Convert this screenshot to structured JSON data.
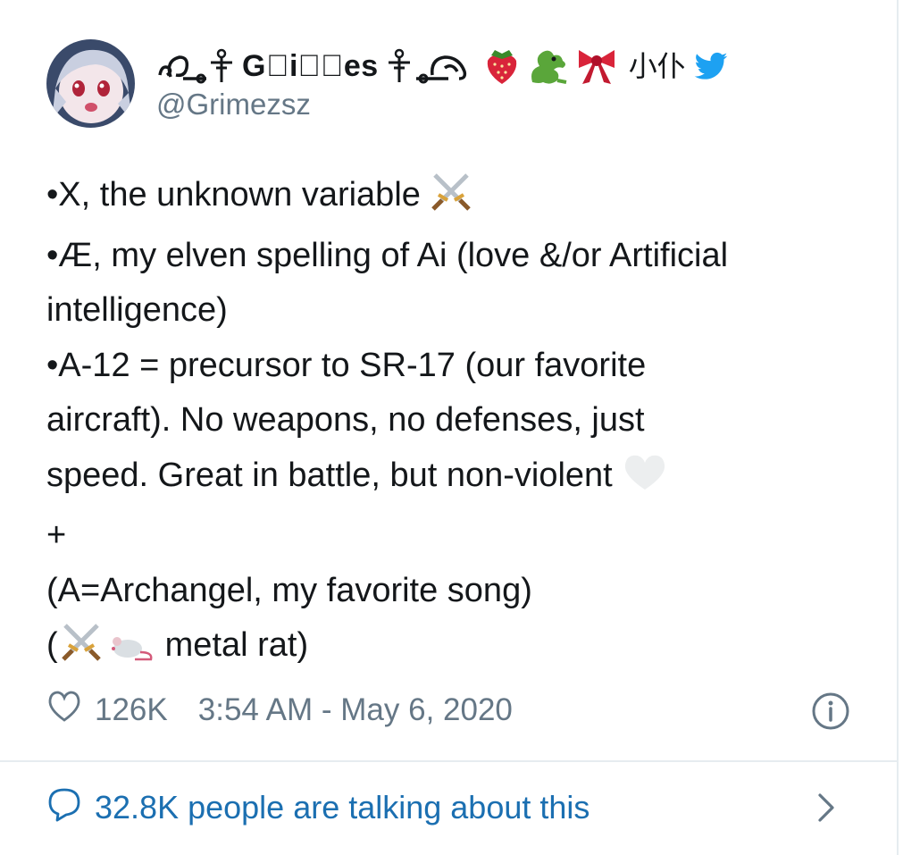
{
  "tweet": {
    "display_name": "G𝕽i⃝⃝es",
    "display_name_suffix": "小仆",
    "handle": "@Grimezsz",
    "lines": [
      "•X, the unknown variable",
      "•Æ, my elven spelling of Ai (love &/or Artificial",
      "intelligence)",
      "•A-12 = precursor to SR-17 (our favorite",
      "aircraft).  No weapons, no defenses, just",
      "speed.  Great in battle, but non-violent",
      "+",
      "(A=Archangel, my favorite song)",
      "(",
      "metal rat)"
    ],
    "likes": "126K",
    "timestamp": "3:54 AM - May 6, 2020",
    "talking": "32.8K people are talking about this"
  },
  "icons": {
    "heart": "heart-outline-icon",
    "info": "info-icon",
    "reply": "speech-bubble-icon",
    "chevron": "chevron-right-icon",
    "swords": "crossed-swords-icon",
    "white_heart": "white-heart-icon",
    "rat": "rat-icon",
    "strawberry": "strawberry-icon",
    "dragon": "dragon-icon",
    "ribbon": "ribbon-icon",
    "bird": "twitter-bird-icon"
  },
  "colors": {
    "link_blue": "#1b6fb1",
    "muted_gray": "#657786",
    "twitter_blue": "#1da1f2"
  }
}
